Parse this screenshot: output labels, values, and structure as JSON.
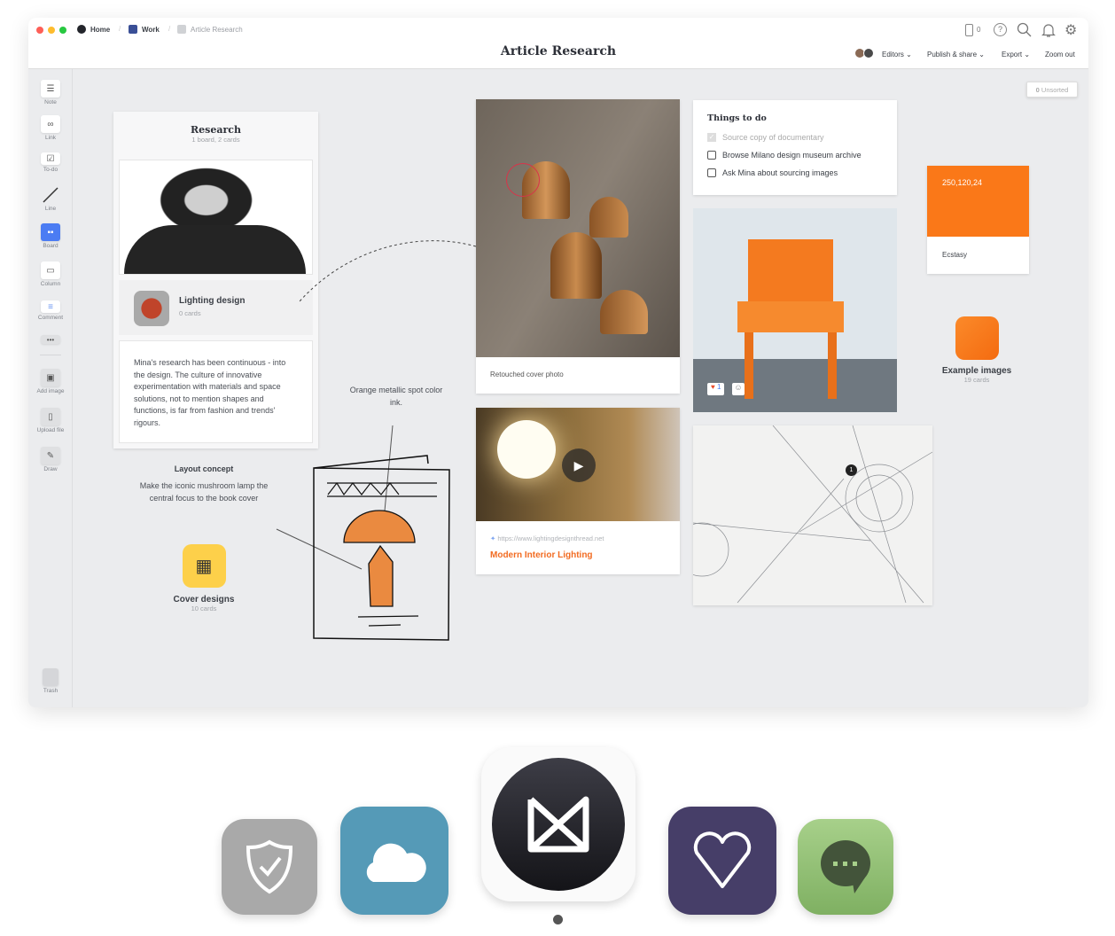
{
  "window": {
    "title": "Article Research",
    "breadcrumbs": [
      {
        "label": "Home",
        "color": "#23252b"
      },
      {
        "label": "Work",
        "color": "#3a4f96"
      },
      {
        "label": "Article Research",
        "color": "#d0d2d5"
      }
    ],
    "header_icons": [
      "mobile-icon",
      "help-icon",
      "search-icon",
      "bell-icon",
      "gear-icon"
    ],
    "mobile_count": "0",
    "menu": {
      "editors": "Editors",
      "publish": "Publish & share",
      "export": "Export",
      "zoom": "Zoom out"
    }
  },
  "sidebar": {
    "tools": [
      {
        "label": "Note",
        "icon": "note-icon"
      },
      {
        "label": "Link",
        "icon": "link-icon"
      },
      {
        "label": "To-do",
        "icon": "todo-icon"
      },
      {
        "label": "Line",
        "icon": "line-icon"
      },
      {
        "label": "Board",
        "icon": "board-icon"
      },
      {
        "label": "Column",
        "icon": "column-icon"
      },
      {
        "label": "Comment",
        "icon": "comment-icon"
      }
    ],
    "more": "•••",
    "actions": [
      {
        "label": "Add image"
      },
      {
        "label": "Upload file"
      },
      {
        "label": "Draw"
      }
    ],
    "trash": "Trash"
  },
  "canvas": {
    "unsorted": {
      "count": "0",
      "label": "Unsorted"
    },
    "research": {
      "title": "Research",
      "subtitle": "1 board, 2 cards",
      "board": {
        "title": "Lighting design",
        "count": "0 cards"
      },
      "note": "Mina's research has been continuous - into the design. The culture of innovative experimentation with materials and space solutions, not to mention shapes and functions, is far from fashion and trends' rigours."
    },
    "layout": {
      "title": "Layout concept",
      "text": "Make the iconic mushroom lamp the central focus to the book cover"
    },
    "cover": {
      "title": "Cover designs",
      "count": "10 cards",
      "color": "#fdd04a"
    },
    "annotation": "Orange metallic spot color ink.",
    "photo_caption": "Retouched cover photo",
    "link": {
      "url": "https://www.lightingdesignthread.net",
      "title": "Modern Interior Lighting",
      "color": "#f26b21"
    },
    "todo": {
      "title": "Things to do",
      "items": [
        {
          "label": "Source copy of documentary",
          "done": true
        },
        {
          "label": "Browse Milano design museum archive",
          "done": false
        },
        {
          "label": "Ask Mina about sourcing images",
          "done": false
        }
      ]
    },
    "chair": {
      "reaction_count": "1"
    },
    "swatch": {
      "value": "250,120,24",
      "name": "Ecstasy",
      "color": "#fa7818"
    },
    "examples": {
      "title": "Example images",
      "count": "19 cards"
    },
    "blueprint_marker": "1"
  },
  "dock": [
    {
      "name": "shield-app",
      "color": "#a9a9a9"
    },
    {
      "name": "cloud-app",
      "color": "#559ab7"
    },
    {
      "name": "milanote-app",
      "color": "#1d1d22"
    },
    {
      "name": "heart-app",
      "color": "#463e68"
    },
    {
      "name": "chat-app",
      "color": "#8ab86c"
    }
  ]
}
